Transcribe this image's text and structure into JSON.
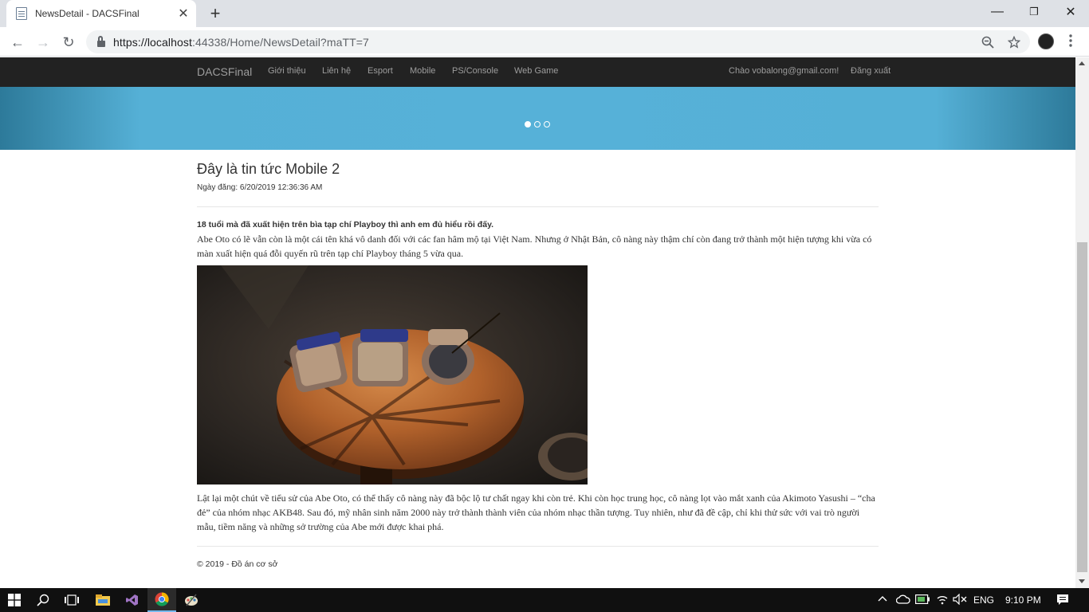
{
  "browser": {
    "tab_title": "NewsDetail - DACSFinal",
    "tab_close": "✕",
    "new_tab": "+",
    "url_host": "https://localhost",
    "url_path": ":44338/Home/NewsDetail?maTT=7",
    "back": "←",
    "forward": "→",
    "reload": "↻",
    "zoom_icon": "zoom-out-icon",
    "bookmark_icon": "star-icon"
  },
  "window": {
    "minimize": "—",
    "maximize": "❐",
    "close": "✕"
  },
  "site": {
    "brand": "DACSFinal",
    "nav": [
      "Giới thiệu",
      "Liên hệ",
      "Esport",
      "Mobile",
      "PS/Console",
      "Web Game"
    ],
    "greeting": "Chào vobalong@gmail.com!",
    "logout": "Đăng xuất"
  },
  "article": {
    "title": "Đây là tin tức Mobile 2",
    "date": "Ngày đăng: 6/20/2019 12:36:36 AM",
    "lead": "18 tuổi mà đã xuất hiện trên bìa tạp chí Playboy thì anh em đủ hiểu rồi đấy.",
    "p1": "Abe Oto có lẽ vẫn còn là một cái tên khá vô danh đối với các fan hâm mộ tại Việt Nam. Nhưng ở Nhật Bản, cô nàng này thậm chí còn đang trở thành một hiện tượng khi vừa có màn xuất hiện quá đỗi quyến rũ trên tạp chí Playboy tháng 5 vừa qua.",
    "p2": "Lật lại một chút về tiểu sử của Abe Oto, có thể thấy cô nàng này đã bộc lộ tư chất ngay khi còn trẻ. Khi còn học trung học, cô nàng lọt vào mắt xanh của Akimoto Yasushi – “cha đẻ” của nhóm nhạc AKB48. Sau đó, mỹ nhân sinh năm 2000 này trở thành thành viên của nhóm nhạc thần tượng. Tuy  nhiên, như đã đề cập, chỉ khi thử sức với vai trò người mẫu, tiềm năng và những sở trường của Abe mới được khai phá."
  },
  "footer": "© 2019 - Đồ án cơ sở",
  "taskbar": {
    "lang": "ENG",
    "time": "9:10 PM"
  }
}
